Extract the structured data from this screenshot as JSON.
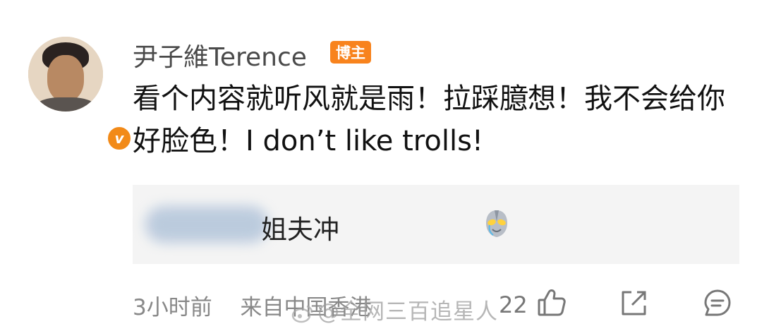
{
  "post": {
    "username": "尹子維Terence",
    "badge": "博主",
    "verified_mark": "v",
    "comment": "看个内容就听风就是雨！拉踩臆想！我不会给你好脸色！I don’t like trolls!"
  },
  "quoted": {
    "text": "姐夫冲",
    "emoji": "ultraman-emoji"
  },
  "footer": {
    "time": "3小时前",
    "source": "来自中国香港",
    "watermark": "@全网三百追星人",
    "like_count": "22"
  },
  "colors": {
    "accent": "#f8831d",
    "text": "#111111",
    "secondary": "#888888",
    "quote_bg": "#f4f4f4"
  },
  "icons": [
    "verified-icon",
    "ultraman-emoji",
    "like-icon",
    "share-icon",
    "comment-icon"
  ]
}
